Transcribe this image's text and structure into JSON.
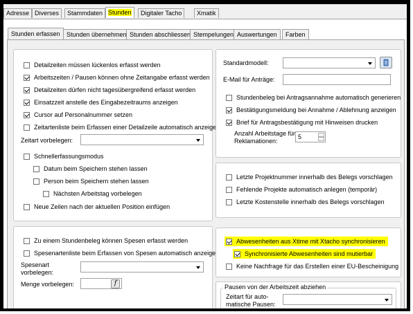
{
  "main_tabs": [
    "Adresse",
    "Diverses",
    "Stammdaten",
    "Stunden",
    "Digitaler Tacho",
    "Xmatik"
  ],
  "sub_tabs": [
    "Stunden erfassen",
    "Stunden übernehmen",
    "Stunden abschliessen",
    "Stempelungen",
    "Auswertungen",
    "Farben"
  ],
  "left_panel1": {
    "cb0": "Detailzeiten müssen lückenlos erfasst werden",
    "cb1": "Arbeitszeiten / Pausen können ohne Zeitangabe erfasst werden",
    "cb2": "Detailzeiten dürfen nicht tagesübergreifend erfasst werden",
    "cb3": "Einsatzzeit anstelle des Eingabezeitraums anzeigen",
    "cb4": "Cursor auf Personalnummer setzen",
    "cb5": "Zeitartenliste beim Erfassen einer Detailzeile automatisch anzeigen",
    "zeitart_label": "Zeitart vorbelegen:",
    "cb6": "Schnellerfassungsmodus",
    "cb7": "Datum beim Speichern stehen lassen",
    "cb8": "Person beim Speichern stehen lassen",
    "cb9": "Nächsten Arbeitstag vorbelegen",
    "cb10": "Neue Zeilen nach der aktuellen Position einfügen"
  },
  "left_panel2": {
    "cb0": "Zu einem Stundenbeleg können Spesen erfasst werden",
    "cb1": "Spesenartenliste beim Erfassen von Spesen automatisch anzeigen",
    "spesenart_label_line1": "Spesenart",
    "spesenart_label_line2": "vorbelegen:",
    "menge_label": "Menge vorbelegen:",
    "f_button": "f"
  },
  "right_panel1": {
    "standardmodell_label": "Standardmodell:",
    "email_label": "E-Mail für Anträge:",
    "cb0": "Stundenbeleg bei Antragsannahme automatisch generieren",
    "cb1": "Bestätigungsmeldung bei Annahme / Ablehnung anzeigen",
    "cb2": "Brief für Antragsbestätigung mit Hinweisen drucken",
    "anzahl_label_line1": "Anzahl Arbeitstage für",
    "anzahl_label_line2": "Reklamationen:",
    "anzahl_value": "5"
  },
  "right_panel2": {
    "cb0": "Letzte Projektnummer innerhalb des Belegs vorschlagen",
    "cb1": "Fehlende Projekte automatisch anlegen (temporär)",
    "cb2": "Letzte Kostenstelle innerhalb des Belegs vorschlagen"
  },
  "right_panel3": {
    "cb0": "Abwesenheiten aus Xtime mit Xtacho synchronisieren",
    "cb1": "Synchronisierte Abwesenheiten sind mutierbar",
    "cb2": "Keine Nachfrage für das Erstellen einer EU-Bescheinigung"
  },
  "right_panel4": {
    "group_title": "Pausen von der Arbeitszeit abziehen",
    "zeitart_line1": "Zeitart für auto-",
    "zeitart_line2": "matische Pausen:"
  },
  "colors": {
    "highlight": "#ffff00"
  }
}
